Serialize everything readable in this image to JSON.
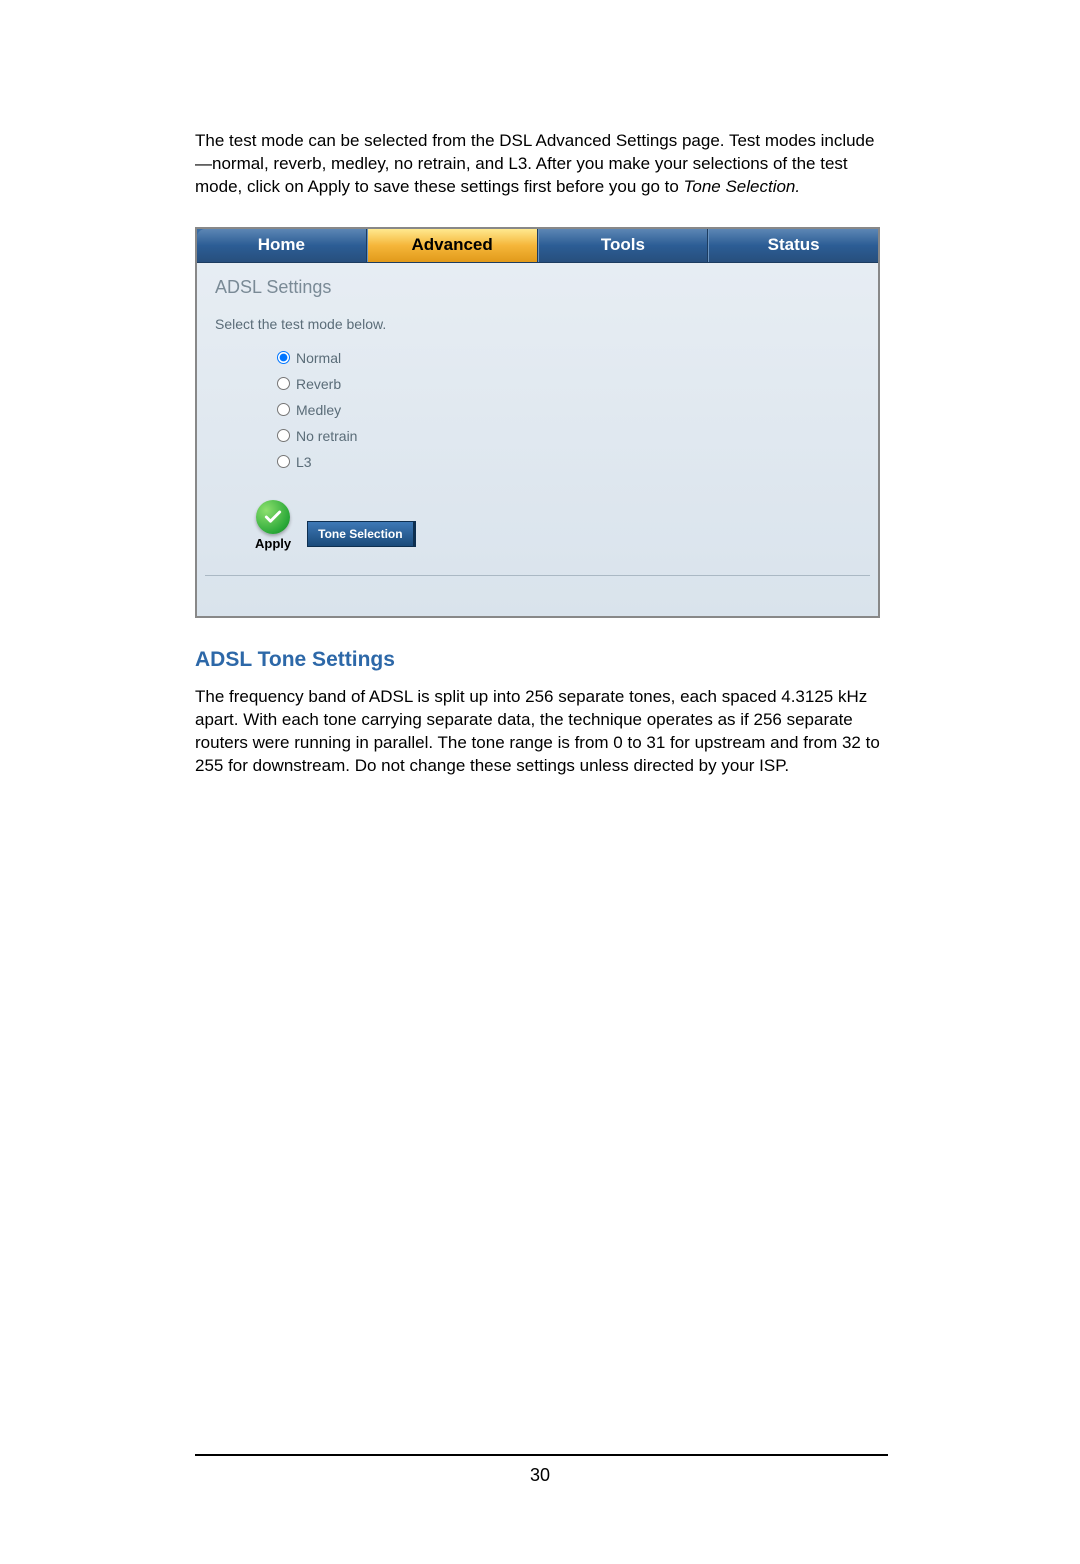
{
  "intro": {
    "part1": "The test mode can be selected from the DSL Advanced Settings page.  Test modes include—normal, reverb, medley, no retrain, and L3.  After you make your selections of the test mode, click on Apply to save these settings first before you go to ",
    "italic": "Tone Selection.",
    "part2": ""
  },
  "tabs": [
    "Home",
    "Advanced",
    "Tools",
    "Status"
  ],
  "activeTab": 1,
  "panel": {
    "title": "ADSL Settings",
    "instruction": "Select the test mode below.",
    "options": [
      "Normal",
      "Reverb",
      "Medley",
      "No retrain",
      "L3"
    ],
    "selected": 0,
    "applyLabel": "Apply",
    "toneBtn": "Tone Selection"
  },
  "section": {
    "heading": "ADSL Tone Settings",
    "body": "The frequency band of ADSL is split up into 256 separate tones, each spaced 4.3125 kHz apart.  With each tone carrying separate data, the technique operates as if 256 separate routers were running in parallel.  The tone range is from 0 to 31 for upstream and from 32 to 255 for downstream.  Do not change these settings unless directed by your ISP."
  },
  "pageNumber": "30"
}
